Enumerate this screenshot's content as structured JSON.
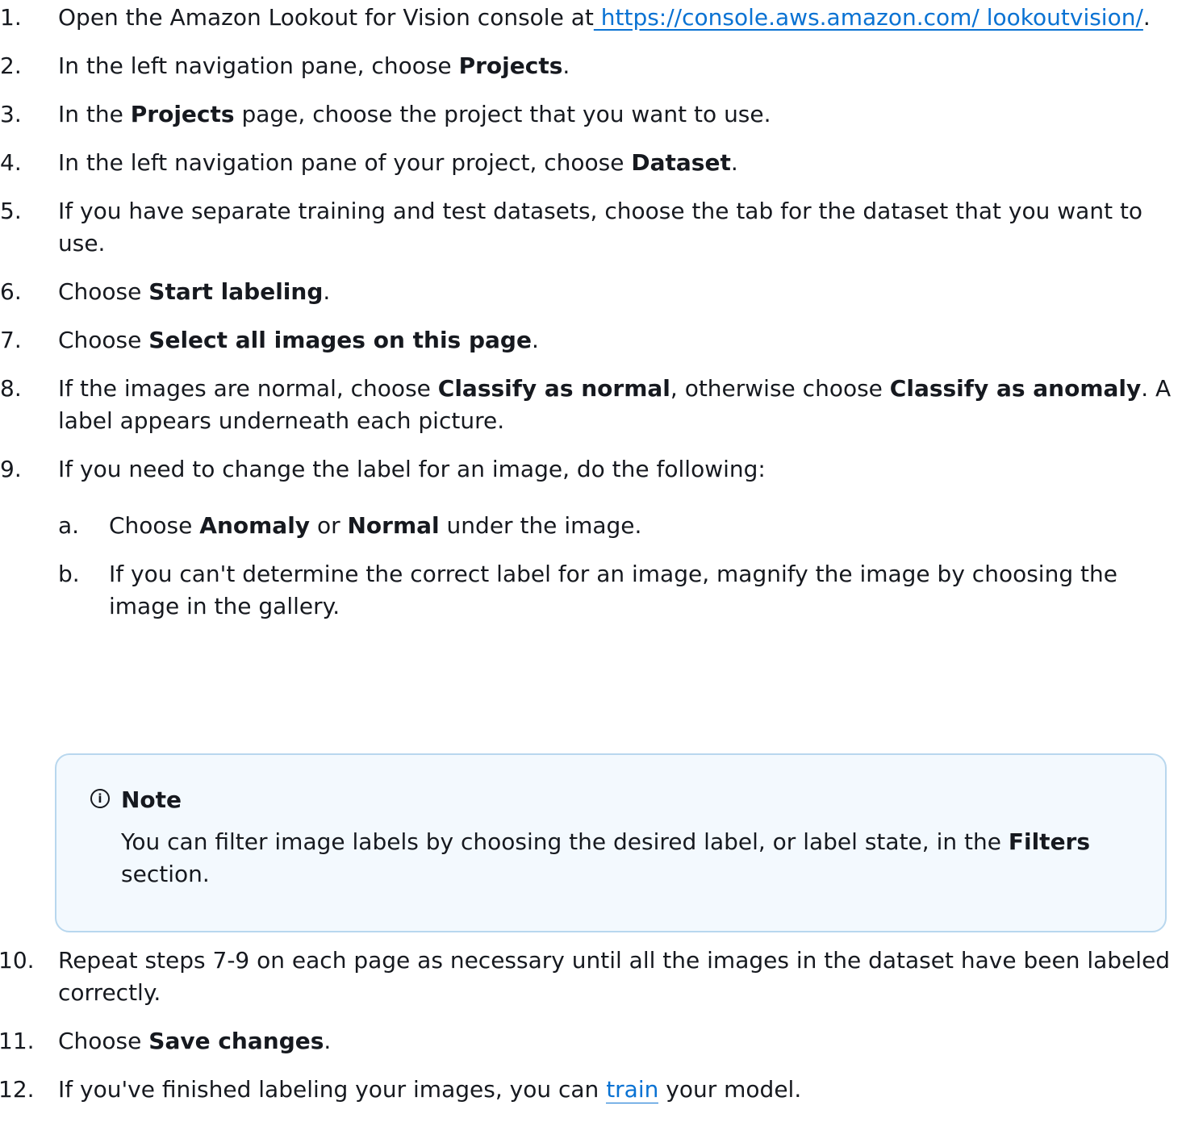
{
  "steps": [
    {
      "num": "1.",
      "pre": "Open the Amazon Lookout for Vision console at",
      "link": " https://console.aws.amazon.com/ lookoutvision/",
      "post": "."
    },
    {
      "num": "2.",
      "pre": "In the left navigation pane, choose ",
      "bold": "Projects",
      "post": "."
    },
    {
      "num": "3.",
      "pre": "In the ",
      "bold": "Projects",
      "post": " page, choose the project that you want to use."
    },
    {
      "num": "4.",
      "pre": "In the left navigation pane of your project, choose ",
      "bold": "Dataset",
      "post": "."
    },
    {
      "num": "5.",
      "text": "If you have separate training and test datasets, choose the tab for the dataset that you want to use."
    },
    {
      "num": "6.",
      "pre": "Choose ",
      "bold": "Start labeling",
      "post": "."
    },
    {
      "num": "7.",
      "pre": "Choose ",
      "bold": "Select all images on this page",
      "post": "."
    },
    {
      "num": "8.",
      "pre": "If the images are normal, choose ",
      "bold": "Classify as normal",
      "mid": ", otherwise choose ",
      "bold2": "Classify as anomaly",
      "post": ". A label appears underneath each picture."
    },
    {
      "num": "9.",
      "text": "If you need to change the label for an image, do the following:"
    }
  ],
  "substeps": [
    {
      "num": "a.",
      "pre": "Choose ",
      "bold": "Anomaly",
      "mid": " or ",
      "bold2": "Normal",
      "post": " under the image."
    },
    {
      "num": "b.",
      "text": "If you can't determine the correct label for an image, magnify the image by choosing the image in the gallery."
    }
  ],
  "note": {
    "icon": "info-icon",
    "title": "Note",
    "pre": "You can filter image labels by choosing the desired label, or label state, in the ",
    "bold": "Filters",
    "post": " section."
  },
  "lower_steps": [
    {
      "num": "10.",
      "text": "Repeat steps 7-9 on each page as necessary until all the images in the dataset have been labeled correctly."
    },
    {
      "num": "11.",
      "pre": "Choose ",
      "bold": "Save changes",
      "post": "."
    },
    {
      "num": "12.",
      "pre": "If you've finished labeling your images, you can ",
      "link": "train",
      "post": " your model."
    }
  ],
  "colors": {
    "text": "#16191f",
    "link": "#0972d3",
    "note_bg": "#f3f9fe",
    "note_border": "#b8d7ee"
  }
}
